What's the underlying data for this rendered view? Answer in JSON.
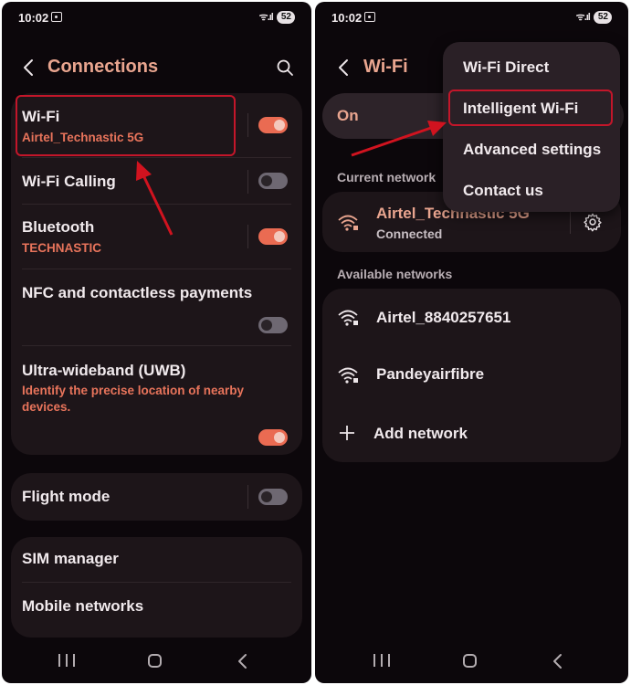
{
  "status_bar": {
    "time": "10:02",
    "signal": "ᯤ.ıl",
    "battery": "52"
  },
  "left": {
    "header": {
      "title": "Connections",
      "back_icon": "chevron-left-icon",
      "search_icon": "search-icon"
    },
    "wifi": {
      "title": "Wi-Fi",
      "subtitle": "Airtel_Technastic 5G",
      "toggle_on": true
    },
    "wifi_calling": {
      "title": "Wi-Fi Calling",
      "toggle_on": false
    },
    "bluetooth": {
      "title": "Bluetooth",
      "subtitle": "TECHNASTIC",
      "toggle_on": true
    },
    "nfc": {
      "title": "NFC and contactless payments",
      "toggle_on": false
    },
    "uwb": {
      "title": "Ultra-wideband (UWB)",
      "description": "Identify the precise location of nearby devices.",
      "toggle_on": true
    },
    "flight_mode": {
      "title": "Flight mode",
      "toggle_on": false
    },
    "sim_manager": {
      "title": "SIM manager"
    },
    "mobile_networks": {
      "title": "Mobile networks"
    }
  },
  "right": {
    "header": {
      "title": "Wi-Fi"
    },
    "on_label": "On",
    "current_network_label": "Current network",
    "current_network": {
      "name": "Airtel_Technastic 5G",
      "status": "Connected",
      "settings_icon": "gear-icon"
    },
    "available_networks_label": "Available networks",
    "available_networks": [
      {
        "name": "Airtel_8840257651"
      },
      {
        "name": "Pandeyairfibre"
      }
    ],
    "add_network": "Add network",
    "menu": {
      "items": [
        "Wi-Fi Direct",
        "Intelligent Wi-Fi",
        "Advanced settings",
        "Contact us"
      ],
      "highlighted": "Intelligent Wi-Fi"
    }
  },
  "colors": {
    "accent": "#e9a58f",
    "toggle_on": "#ea6b52",
    "highlight": "#c3162a",
    "background": "#0c070b",
    "card": "#1d1519"
  }
}
